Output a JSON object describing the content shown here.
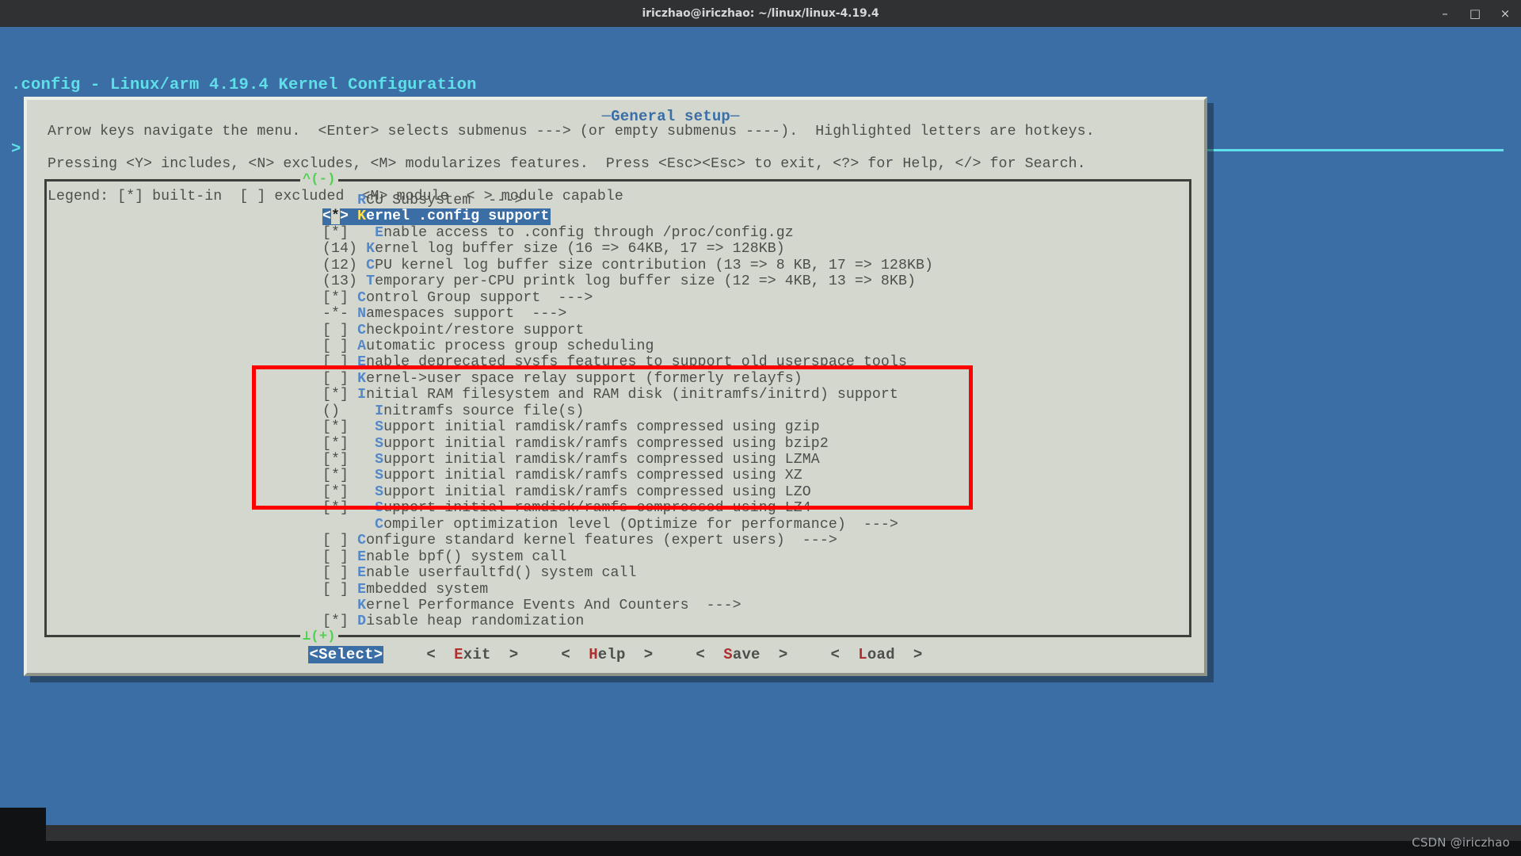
{
  "window": {
    "title": "iriczhao@iriczhao: ~/linux/linux-4.19.4",
    "minimize": "–",
    "maximize": "□",
    "close": "×"
  },
  "nconfig": {
    "header_line1": ".config - Linux/arm 4.19.4 Kernel Configuration",
    "header_line2": "> General setup",
    "dialog_title": "General setup",
    "help_line1": "Arrow keys navigate the menu.  <Enter> selects submenus ---> (or empty submenus ----).  Highlighted letters are hotkeys.",
    "help_line2": "Pressing <Y> includes, <N> excludes, <M> modularizes features.  Press <Esc><Esc> to exit, <?> for Help, </> for Search.",
    "help_line3": "Legend: [*] built-in  [ ] excluded  <M> module  < > module capable",
    "scroll_up": "^(-)",
    "scroll_down": "⊥(+)"
  },
  "menu_items": [
    {
      "prefix": "    ",
      "hot": "R",
      "rest": "CU Subsystem  --->",
      "selected": false
    },
    {
      "prefix": "<*> ",
      "hot": "K",
      "rest": "ernel .config support",
      "selected": true
    },
    {
      "prefix": "[*]   ",
      "hot": "E",
      "rest": "nable access to .config through /proc/config.gz",
      "selected": false
    },
    {
      "prefix": "(14) ",
      "hot": "K",
      "rest": "ernel log buffer size (16 => 64KB, 17 => 128KB)",
      "selected": false
    },
    {
      "prefix": "(12) ",
      "hot": "C",
      "rest": "PU kernel log buffer size contribution (13 => 8 KB, 17 => 128KB)",
      "selected": false
    },
    {
      "prefix": "(13) ",
      "hot": "T",
      "rest": "emporary per-CPU printk log buffer size (12 => 4KB, 13 => 8KB)",
      "selected": false
    },
    {
      "prefix": "[*] ",
      "hot": "C",
      "rest": "ontrol Group support  --->",
      "selected": false
    },
    {
      "prefix": "-*- ",
      "hot": "N",
      "rest": "amespaces support  --->",
      "selected": false
    },
    {
      "prefix": "[ ] ",
      "hot": "C",
      "rest": "heckpoint/restore support",
      "selected": false
    },
    {
      "prefix": "[ ] ",
      "hot": "A",
      "rest": "utomatic process group scheduling",
      "selected": false
    },
    {
      "prefix": "[ ] ",
      "hot": "E",
      "rest": "nable deprecated sysfs features to support old userspace tools",
      "selected": false
    },
    {
      "prefix": "[ ] ",
      "hot": "K",
      "rest": "ernel->user space relay support (formerly relayfs)",
      "selected": false
    },
    {
      "prefix": "[*] ",
      "hot": "I",
      "rest": "nitial RAM filesystem and RAM disk (initramfs/initrd) support",
      "selected": false
    },
    {
      "prefix": "()    ",
      "hot": "I",
      "rest": "nitramfs source file(s)",
      "selected": false
    },
    {
      "prefix": "[*]   ",
      "hot": "S",
      "rest": "upport initial ramdisk/ramfs compressed using gzip",
      "selected": false
    },
    {
      "prefix": "[*]   ",
      "hot": "S",
      "rest": "upport initial ramdisk/ramfs compressed using bzip2",
      "selected": false
    },
    {
      "prefix": "[*]   ",
      "hot": "S",
      "rest": "upport initial ramdisk/ramfs compressed using LZMA",
      "selected": false
    },
    {
      "prefix": "[*]   ",
      "hot": "S",
      "rest": "upport initial ramdisk/ramfs compressed using XZ",
      "selected": false
    },
    {
      "prefix": "[*]   ",
      "hot": "S",
      "rest": "upport initial ramdisk/ramfs compressed using LZO",
      "selected": false
    },
    {
      "prefix": "[*]   ",
      "hot": "S",
      "rest": "upport initial ramdisk/ramfs compressed using LZ4",
      "selected": false
    },
    {
      "prefix": "      ",
      "hot": "C",
      "rest": "ompiler optimization level (Optimize for performance)  --->",
      "selected": false
    },
    {
      "prefix": "[ ] ",
      "hot": "C",
      "rest": "onfigure standard kernel features (expert users)  --->",
      "selected": false
    },
    {
      "prefix": "[ ] ",
      "hot": "E",
      "rest": "nable bpf() system call",
      "selected": false
    },
    {
      "prefix": "[ ] ",
      "hot": "E",
      "rest": "nable userfaultfd() system call",
      "selected": false
    },
    {
      "prefix": "[ ] ",
      "hot": "E",
      "rest": "mbedded system",
      "selected": false
    },
    {
      "prefix": "    ",
      "hot": "K",
      "rest": "ernel Performance Events And Counters  --->",
      "selected": false
    },
    {
      "prefix": "[*] ",
      "hot": "D",
      "rest": "isable heap randomization",
      "selected": false
    }
  ],
  "buttons": [
    {
      "pre": "<",
      "hot": "S",
      "post": "elect>",
      "active": true
    },
    {
      "pre": "<  ",
      "hot": "E",
      "post": "xit  >",
      "active": false
    },
    {
      "pre": "<  ",
      "hot": "H",
      "post": "elp  >",
      "active": false
    },
    {
      "pre": "<  ",
      "hot": "S",
      "post": "ave  >",
      "active": false
    },
    {
      "pre": "<  ",
      "hot": "L",
      "post": "oad  >",
      "active": false
    }
  ],
  "annotation": {
    "color": "#ff0000"
  },
  "watermark": "CSDN @iriczhao"
}
